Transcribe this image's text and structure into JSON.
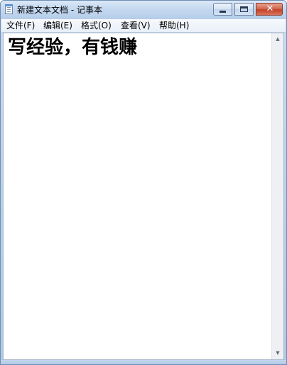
{
  "window": {
    "title": "新建文本文档 - 记事本",
    "close_glyph": "✕"
  },
  "menu": {
    "items": [
      {
        "label": "文件(F)"
      },
      {
        "label": "编辑(E)"
      },
      {
        "label": "格式(O)"
      },
      {
        "label": "查看(V)"
      },
      {
        "label": "帮助(H)"
      }
    ]
  },
  "editor": {
    "content": "写经验，有钱赚"
  },
  "scrollbar": {
    "up_glyph": "▲",
    "down_glyph": "▼"
  },
  "icons": {
    "app": "notepad-icon",
    "minimize": "minimize-icon",
    "maximize": "maximize-icon",
    "close": "close-icon"
  },
  "colors": {
    "titlebar": "#c2d7ef",
    "close_button": "#c2432a",
    "menubar": "#f0f5fb"
  }
}
